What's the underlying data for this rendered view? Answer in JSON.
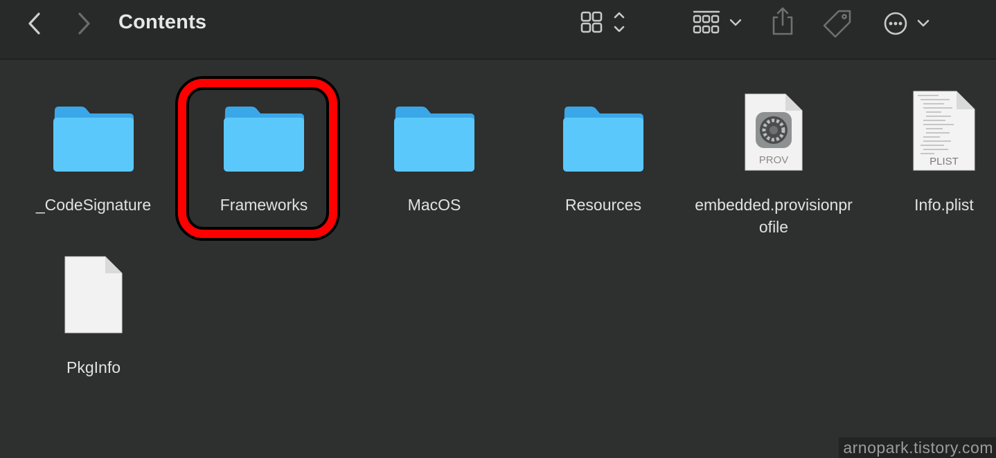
{
  "window": {
    "title": "Contents"
  },
  "toolbar": {
    "back_icon": "chevron-left-icon",
    "forward_icon": "chevron-right-icon",
    "view_icon": "icon-view-grid-icon",
    "group_icon": "group-by-icon",
    "share_icon": "share-icon",
    "tag_icon": "tag-icon",
    "more_icon": "more-actions-icon"
  },
  "items": [
    {
      "name": "_CodeSignature",
      "kind": "folder"
    },
    {
      "name": "Frameworks",
      "kind": "folder",
      "highlighted": true
    },
    {
      "name": "MacOS",
      "kind": "folder"
    },
    {
      "name": "Resources",
      "kind": "folder"
    },
    {
      "name": "embedded.provisionprofile",
      "kind": "document",
      "badge": "PROV"
    },
    {
      "name": "Info.plist",
      "kind": "document",
      "badge": "PLIST"
    },
    {
      "name": "PkgInfo",
      "kind": "document"
    }
  ],
  "colors": {
    "folder": "#5ac8fa",
    "folder_dark": "#3aa7e8",
    "highlight": "#ff0000",
    "background": "#2e2f2f"
  },
  "watermark": "arnopark.tistory.com"
}
